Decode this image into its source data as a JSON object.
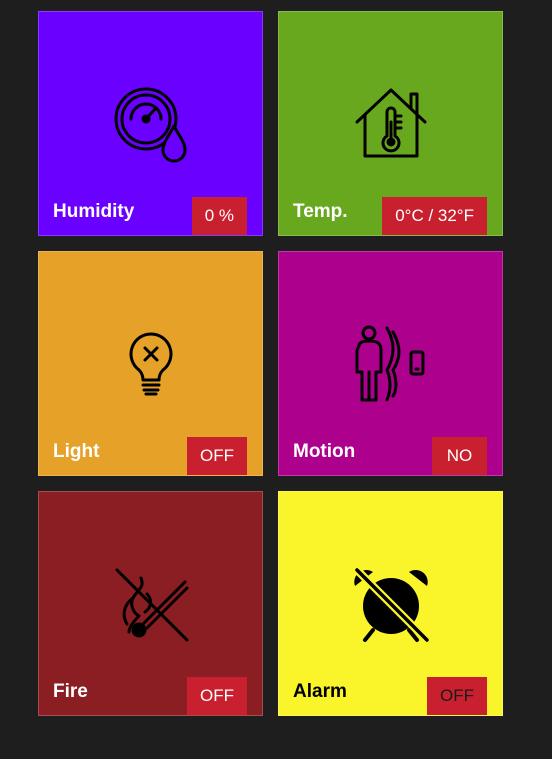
{
  "tiles": [
    {
      "id": "humidity",
      "label": "Humidity",
      "value": "0 %",
      "bg": "#6a00ff",
      "icon": "humidity-gauge-icon"
    },
    {
      "id": "temp",
      "label": "Temp.",
      "value": "0°C / 32°F",
      "bg": "#68a81e",
      "icon": "house-thermometer-icon"
    },
    {
      "id": "light",
      "label": "Light",
      "value": "OFF",
      "bg": "#e6a128",
      "icon": "lightbulb-off-icon"
    },
    {
      "id": "motion",
      "label": "Motion",
      "value": "NO",
      "bg": "#ad008c",
      "icon": "motion-sensor-icon"
    },
    {
      "id": "fire",
      "label": "Fire",
      "value": "OFF",
      "bg": "#8a1e22",
      "icon": "fire-off-icon"
    },
    {
      "id": "alarm",
      "label": "Alarm",
      "value": "OFF",
      "bg": "#f9f52a",
      "icon": "alarm-off-icon"
    }
  ],
  "colors": {
    "page_bg": "#1e1e1e",
    "badge_bg": "#c8202f"
  }
}
